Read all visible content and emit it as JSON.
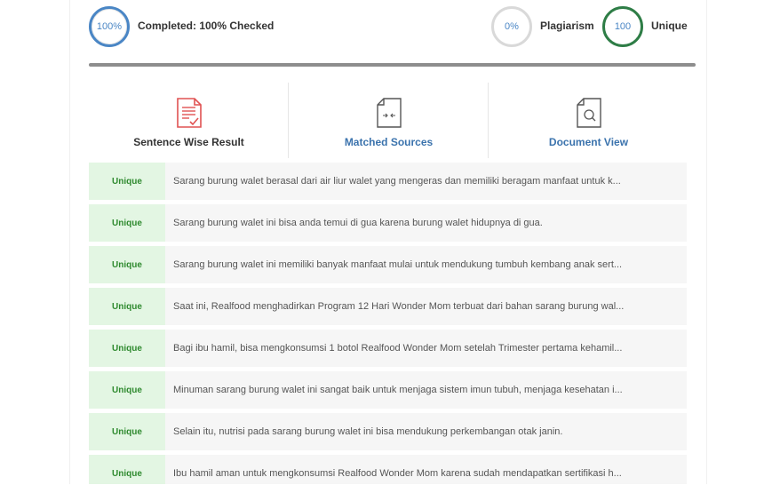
{
  "summary": {
    "progress_value": "100%",
    "completed_text": "Completed: 100% Checked",
    "plagiarism_value": "0%",
    "plagiarism_label": "Plagiarism",
    "unique_value": "100",
    "unique_label": "Unique"
  },
  "tabs": [
    {
      "label": "Sentence Wise Result",
      "icon": "document-check-icon",
      "color": "#333333"
    },
    {
      "label": "Matched Sources",
      "icon": "document-compare-icon",
      "color": "#3b73ad"
    },
    {
      "label": "Document View",
      "icon": "document-search-icon",
      "color": "#3b73ad"
    }
  ],
  "colors": {
    "accent": "#4a86c5",
    "unique_green": "#2e7d46",
    "badge_bg": "#e3f6e3",
    "badge_text": "#2f8a2f",
    "icon_red": "#e05252"
  },
  "results": [
    {
      "status": "Unique",
      "text": "Sarang burung walet berasal dari air liur walet yang mengeras dan memiliki beragam manfaat untuk k..."
    },
    {
      "status": "Unique",
      "text": "Sarang burung walet ini bisa anda temui di gua karena burung walet hidupnya di gua."
    },
    {
      "status": "Unique",
      "text": "Sarang burung walet ini memiliki banyak manfaat mulai untuk mendukung tumbuh kembang anak sert..."
    },
    {
      "status": "Unique",
      "text": "Saat ini, Realfood menghadirkan Program 12 Hari Wonder Mom terbuat dari bahan sarang burung wal..."
    },
    {
      "status": "Unique",
      "text": "Bagi ibu hamil, bisa mengkonsumsi 1 botol Realfood Wonder Mom setelah Trimester pertama kehamil..."
    },
    {
      "status": "Unique",
      "text": "Minuman sarang burung walet ini sangat baik untuk menjaga sistem imun tubuh, menjaga kesehatan i..."
    },
    {
      "status": "Unique",
      "text": "Selain itu, nutrisi pada sarang burung walet ini bisa mendukung perkembangan otak janin."
    },
    {
      "status": "Unique",
      "text": "Ibu hamil aman untuk mengkonsumsi Realfood Wonder Mom karena sudah mendapatkan sertifikasi h..."
    }
  ]
}
